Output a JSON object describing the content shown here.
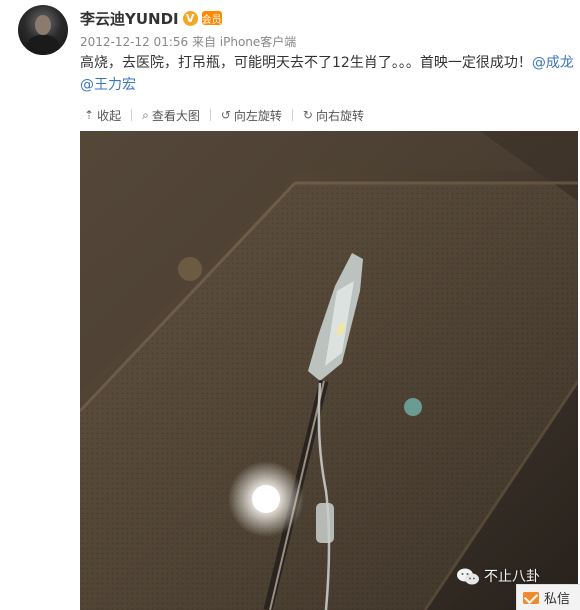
{
  "post": {
    "username": "李云迪YUNDI",
    "verified_badge": "V",
    "vip_badge": "会员",
    "timestamp": "2012-12-12 01:56",
    "source": "来自 iPhone客户端",
    "text_main": "高烧，去医院，打吊瓶，可能明天去不了12生肖了。。。首映一定很成功！",
    "mention_1": "@成龙",
    "mention_2": "@王力宏"
  },
  "toolbar": {
    "collapse": "收起",
    "view_large": "查看大图",
    "rotate_left": "向左旋转",
    "rotate_right": "向右旋转",
    "icons": [
      "up-arrow-icon",
      "zoom-icon",
      "rotate-left-icon",
      "rotate-right-icon"
    ]
  },
  "overlay": {
    "watermark": "不止八卦",
    "private_message": "私信"
  },
  "colors": {
    "mention": "#3b76c4",
    "verified": "#f5a623",
    "pm_icon": "#f08a2a"
  }
}
